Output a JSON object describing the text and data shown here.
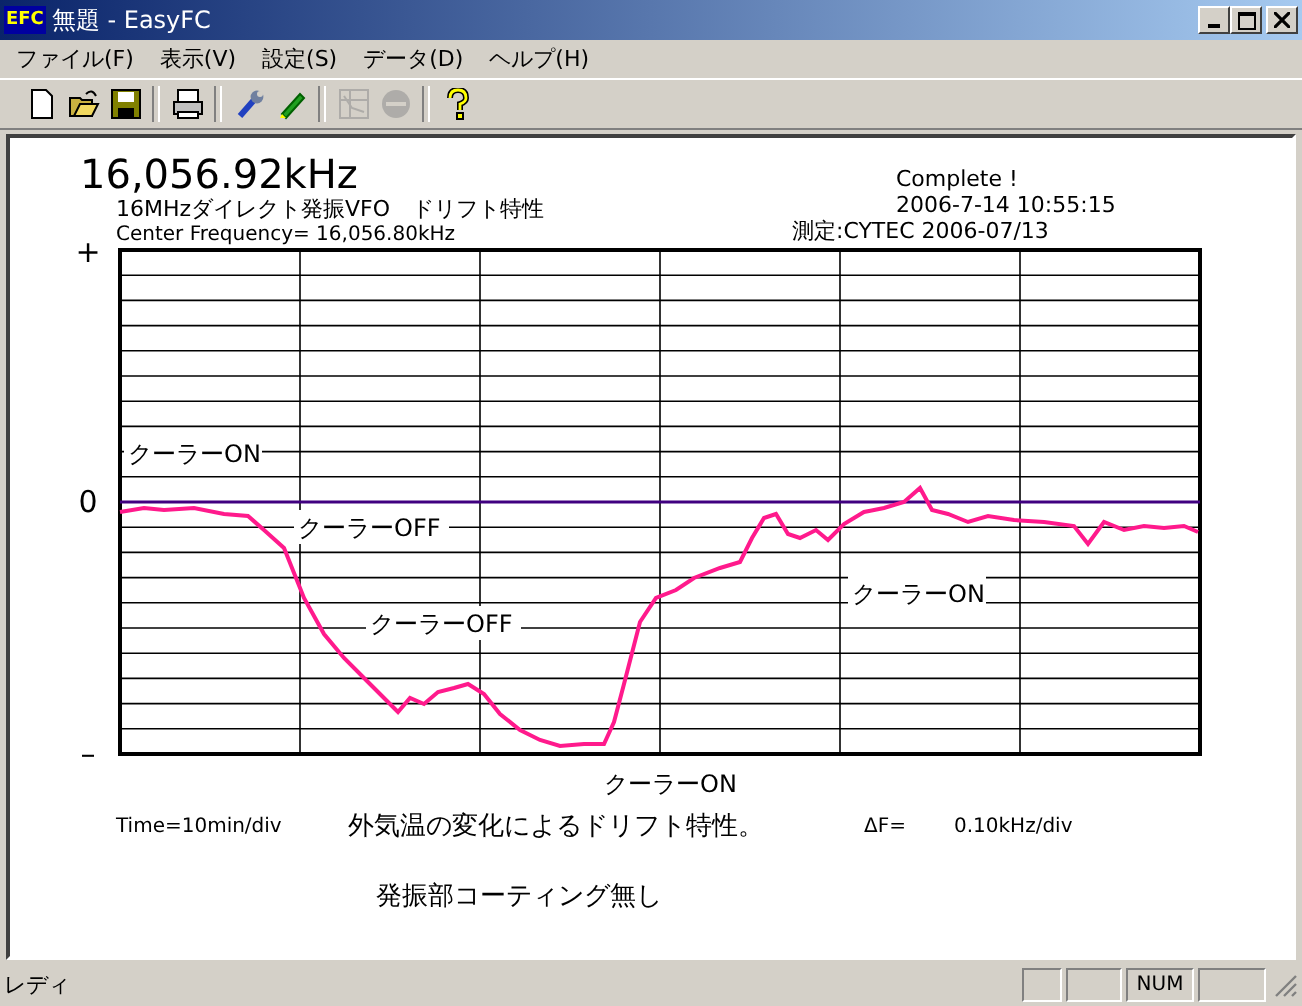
{
  "window": {
    "title": "無題 - EasyFC",
    "app_icon": "EFC"
  },
  "menu": [
    "ファイル(F)",
    "表示(V)",
    "設定(S)",
    "データ(D)",
    "ヘルプ(H)"
  ],
  "toolbar": [
    {
      "kind": "new",
      "disabled": false
    },
    {
      "kind": "open",
      "disabled": false
    },
    {
      "kind": "save",
      "disabled": false
    },
    {
      "kind": "print",
      "disabled": false
    },
    {
      "kind": "wrench",
      "disabled": false
    },
    {
      "kind": "pen",
      "disabled": false
    },
    {
      "kind": "graph",
      "disabled": true
    },
    {
      "kind": "stop",
      "disabled": true
    },
    {
      "kind": "help",
      "disabled": false
    }
  ],
  "report": {
    "frequency": "16,056.92kHz",
    "title": "16MHzダイレクト発振VFO　ドリフト特性",
    "center_frequency": "Center Frequency= 16,056.80kHz",
    "status": "Complete !",
    "datetime": "2006-7-14  10:55:15",
    "measured": "測定:CYTEC  2006-07/13"
  },
  "graph": {
    "y_labels": [
      "+",
      "0",
      "–"
    ],
    "annotations": [
      "クーラーON",
      "クーラーOFF",
      "クーラーOFF",
      "クーラーON",
      "クーラーON"
    ]
  },
  "footer": {
    "time_div": "Time=10min/div",
    "caption": "外気温の変化によるドリフト特性。",
    "delta_label": "ΔF=",
    "delta_value": "0.10kHz/div",
    "note": "発振部コーティング無し"
  },
  "status_bar": {
    "text": "レディ",
    "indicators": [
      "NUM"
    ]
  }
}
